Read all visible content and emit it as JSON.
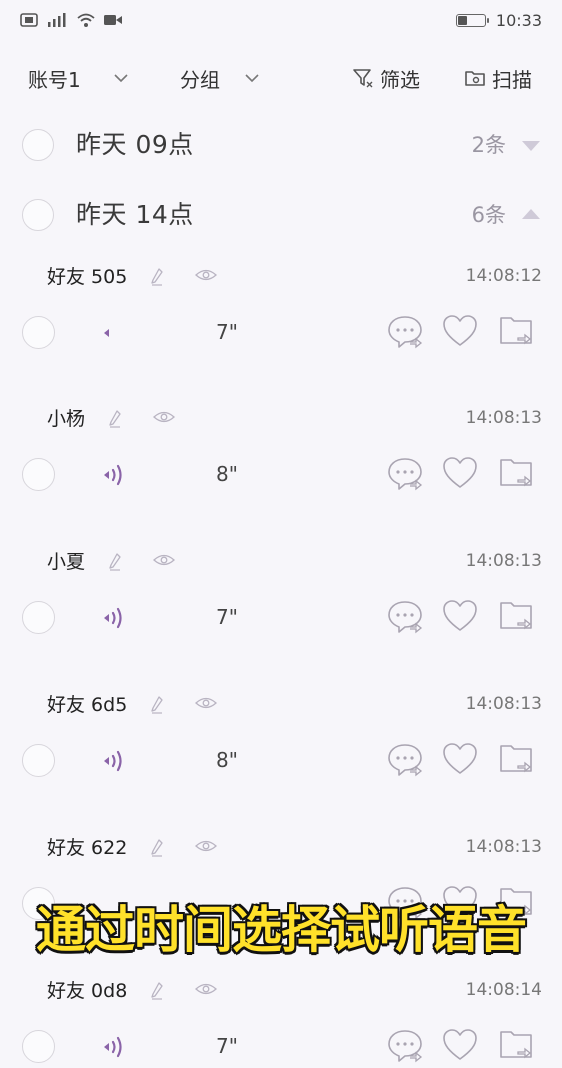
{
  "status_bar": {
    "time": "10:33",
    "battery_level": 0.35
  },
  "filter_bar": {
    "account_label": "账号1",
    "group_label": "分组",
    "filter_label": "筛选",
    "scan_label": "扫描"
  },
  "groups": [
    {
      "title": "昨天 09点",
      "count": "2条",
      "expanded": false
    },
    {
      "title": "昨天 14点",
      "count": "6条",
      "expanded": true
    }
  ],
  "messages": [
    {
      "name": "好友 505",
      "time": "14:08:12",
      "duration": "7\""
    },
    {
      "name": "小杨",
      "time": "14:08:13",
      "duration": "8\""
    },
    {
      "name": "小夏",
      "time": "14:08:13",
      "duration": "7\""
    },
    {
      "name": "好友 6d5",
      "time": "14:08:13",
      "duration": "8\""
    },
    {
      "name": "好友 622",
      "time": "14:08:13",
      "duration": ""
    },
    {
      "name": "好友 0d8",
      "time": "14:08:14",
      "duration": "7\""
    }
  ],
  "overlay_caption": "通过时间选择试听语音",
  "colors": {
    "accent_purple": "#8a63a8",
    "caption_yellow": "#ffe12a"
  }
}
